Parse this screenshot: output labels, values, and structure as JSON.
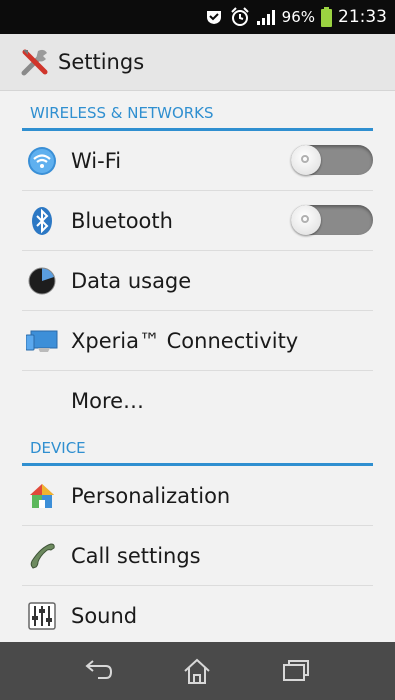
{
  "status_bar": {
    "battery_percent": "96%",
    "time": "21:33",
    "icons": [
      "android-debug-icon",
      "alarm-clock-icon",
      "signal-icon",
      "battery-icon"
    ]
  },
  "action_bar": {
    "title": "Settings",
    "icon": "settings-tools-icon"
  },
  "sections": [
    {
      "header": "WIRELESS & NETWORKS",
      "items": [
        {
          "label": "Wi-Fi",
          "icon": "wifi-icon",
          "toggle": "off"
        },
        {
          "label": "Bluetooth",
          "icon": "bluetooth-icon",
          "toggle": "off"
        },
        {
          "label": "Data usage",
          "icon": "data-usage-icon"
        },
        {
          "label": "Xperia™ Connectivity",
          "icon": "xperia-connectivity-icon"
        },
        {
          "label": "More…"
        }
      ]
    },
    {
      "header": "DEVICE",
      "items": [
        {
          "label": "Personalization",
          "icon": "personalization-icon"
        },
        {
          "label": "Call settings",
          "icon": "phone-icon"
        },
        {
          "label": "Sound",
          "icon": "sound-equalizer-icon"
        }
      ]
    }
  ],
  "nav_bar": {
    "buttons": [
      "back-icon",
      "home-icon",
      "recent-apps-icon"
    ]
  },
  "colors": {
    "accent": "#2f8fd0",
    "background": "#f2f2f2",
    "nav_bar": "#4a4a4a"
  }
}
